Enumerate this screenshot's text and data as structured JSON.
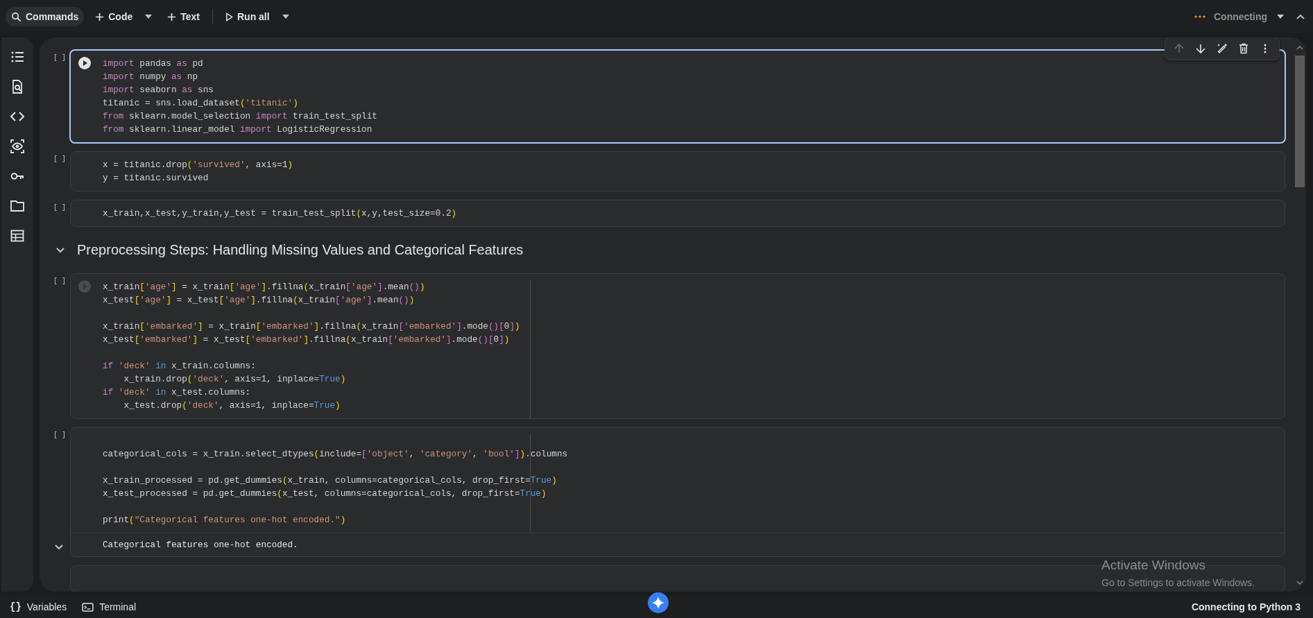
{
  "toolbar": {
    "commands": "Commands",
    "add_code": "Code",
    "add_text": "Text",
    "run_all": "Run all",
    "status": "Connecting"
  },
  "cell_toolbar": {
    "move_up_disabled": true
  },
  "cells": [
    {
      "kind": "code",
      "selected": true,
      "exec": "[ ]",
      "run_button": true,
      "run_button_dim": false,
      "ruler": false,
      "leading_blank": false,
      "blocks": [
        [
          [
            {
              "text": "import",
              "kind": "kw"
            },
            {
              "text": " pandas ",
              "kind": "p"
            },
            {
              "text": "as",
              "kind": "kw"
            },
            {
              "text": " pd",
              "kind": "p"
            }
          ],
          [
            {
              "text": "import",
              "kind": "kw"
            },
            {
              "text": " numpy ",
              "kind": "p"
            },
            {
              "text": "as",
              "kind": "kw"
            },
            {
              "text": " np",
              "kind": "p"
            }
          ],
          [
            {
              "text": "import",
              "kind": "kw"
            },
            {
              "text": " seaborn ",
              "kind": "p"
            },
            {
              "text": "as",
              "kind": "kw"
            },
            {
              "text": " sns",
              "kind": "p"
            }
          ],
          [
            {
              "text": "titanic = sns.load_dataset",
              "kind": "p"
            },
            {
              "text": "(",
              "kind": "b1"
            },
            {
              "text": "'titanic'",
              "kind": "s"
            },
            {
              "text": ")",
              "kind": "b1"
            }
          ],
          [
            {
              "text": "from",
              "kind": "kw"
            },
            {
              "text": " sklearn.model_selection ",
              "kind": "p"
            },
            {
              "text": "import",
              "kind": "kw"
            },
            {
              "text": " train_test_split",
              "kind": "p"
            }
          ],
          [
            {
              "text": "from",
              "kind": "kw"
            },
            {
              "text": " sklearn.linear_model ",
              "kind": "p"
            },
            {
              "text": "import",
              "kind": "kw"
            },
            {
              "text": " LogisticRegression",
              "kind": "p"
            }
          ]
        ]
      ]
    },
    {
      "kind": "code",
      "selected": false,
      "exec": "[ ]",
      "run_button": false,
      "ruler": false,
      "leading_blank": false,
      "blocks": [
        [
          [
            {
              "text": "x = titanic.drop",
              "kind": "p"
            },
            {
              "text": "(",
              "kind": "b1"
            },
            {
              "text": "'survived'",
              "kind": "s"
            },
            {
              "text": ", axis=1",
              "kind": "p"
            },
            {
              "text": ")",
              "kind": "b1"
            }
          ],
          [
            {
              "text": "y = titanic.survived",
              "kind": "p"
            }
          ]
        ]
      ]
    },
    {
      "kind": "code",
      "selected": false,
      "exec": "[ ]",
      "run_button": false,
      "ruler": false,
      "leading_blank": false,
      "blocks": [
        [
          [
            {
              "text": "x_train,x_test,y_train,y_test = train_test_split",
              "kind": "p"
            },
            {
              "text": "(",
              "kind": "b1"
            },
            {
              "text": "x,y,test_size=0.2",
              "kind": "p"
            },
            {
              "text": ")",
              "kind": "b1"
            }
          ]
        ]
      ]
    },
    {
      "kind": "heading",
      "text": "Preprocessing Steps: Handling Missing Values and Categorical Features",
      "expanded": true
    },
    {
      "kind": "code",
      "selected": false,
      "exec": "[ ]",
      "run_button": true,
      "run_button_dim": true,
      "ruler": true,
      "leading_blank": false,
      "blocks": [
        [
          [
            {
              "text": "x_train",
              "kind": "p"
            },
            {
              "text": "[",
              "kind": "b1"
            },
            {
              "text": "'age'",
              "kind": "s"
            },
            {
              "text": "]",
              "kind": "b1"
            },
            {
              "text": " = x_train",
              "kind": "p"
            },
            {
              "text": "[",
              "kind": "b1"
            },
            {
              "text": "'age'",
              "kind": "s"
            },
            {
              "text": "]",
              "kind": "b1"
            },
            {
              "text": ".fillna",
              "kind": "p"
            },
            {
              "text": "(",
              "kind": "b1"
            },
            {
              "text": "x_train",
              "kind": "p"
            },
            {
              "text": "[",
              "kind": "b2"
            },
            {
              "text": "'age'",
              "kind": "s"
            },
            {
              "text": "]",
              "kind": "b2"
            },
            {
              "text": ".mean",
              "kind": "p"
            },
            {
              "text": "()",
              "kind": "b2"
            },
            {
              "text": ")",
              "kind": "b1"
            }
          ],
          [
            {
              "text": "x_test",
              "kind": "p"
            },
            {
              "text": "[",
              "kind": "b1"
            },
            {
              "text": "'age'",
              "kind": "s"
            },
            {
              "text": "]",
              "kind": "b1"
            },
            {
              "text": " = x_test",
              "kind": "p"
            },
            {
              "text": "[",
              "kind": "b1"
            },
            {
              "text": "'age'",
              "kind": "s"
            },
            {
              "text": "]",
              "kind": "b1"
            },
            {
              "text": ".fillna",
              "kind": "p"
            },
            {
              "text": "(",
              "kind": "b1"
            },
            {
              "text": "x_train",
              "kind": "p"
            },
            {
              "text": "[",
              "kind": "b2"
            },
            {
              "text": "'age'",
              "kind": "s"
            },
            {
              "text": "]",
              "kind": "b2"
            },
            {
              "text": ".mean",
              "kind": "p"
            },
            {
              "text": "()",
              "kind": "b2"
            },
            {
              "text": ")",
              "kind": "b1"
            }
          ]
        ],
        [
          [
            {
              "text": "x_train",
              "kind": "p"
            },
            {
              "text": "[",
              "kind": "b1"
            },
            {
              "text": "'embarked'",
              "kind": "s"
            },
            {
              "text": "]",
              "kind": "b1"
            },
            {
              "text": " = x_train",
              "kind": "p"
            },
            {
              "text": "[",
              "kind": "b1"
            },
            {
              "text": "'embarked'",
              "kind": "s"
            },
            {
              "text": "]",
              "kind": "b1"
            },
            {
              "text": ".fillna",
              "kind": "p"
            },
            {
              "text": "(",
              "kind": "b1"
            },
            {
              "text": "x_train",
              "kind": "p"
            },
            {
              "text": "[",
              "kind": "b2"
            },
            {
              "text": "'embarked'",
              "kind": "s"
            },
            {
              "text": "]",
              "kind": "b2"
            },
            {
              "text": ".mode",
              "kind": "p"
            },
            {
              "text": "()",
              "kind": "b2"
            },
            {
              "text": "[",
              "kind": "b2"
            },
            {
              "text": "0",
              "kind": "p"
            },
            {
              "text": "]",
              "kind": "b2"
            },
            {
              "text": ")",
              "kind": "b1"
            }
          ],
          [
            {
              "text": "x_test",
              "kind": "p"
            },
            {
              "text": "[",
              "kind": "b1"
            },
            {
              "text": "'embarked'",
              "kind": "s"
            },
            {
              "text": "]",
              "kind": "b1"
            },
            {
              "text": " = x_test",
              "kind": "p"
            },
            {
              "text": "[",
              "kind": "b1"
            },
            {
              "text": "'embarked'",
              "kind": "s"
            },
            {
              "text": "]",
              "kind": "b1"
            },
            {
              "text": ".fillna",
              "kind": "p"
            },
            {
              "text": "(",
              "kind": "b1"
            },
            {
              "text": "x_train",
              "kind": "p"
            },
            {
              "text": "[",
              "kind": "b2"
            },
            {
              "text": "'embarked'",
              "kind": "s"
            },
            {
              "text": "]",
              "kind": "b2"
            },
            {
              "text": ".mode",
              "kind": "p"
            },
            {
              "text": "()",
              "kind": "b2"
            },
            {
              "text": "[",
              "kind": "b2"
            },
            {
              "text": "0",
              "kind": "p"
            },
            {
              "text": "]",
              "kind": "b2"
            },
            {
              "text": ")",
              "kind": "b1"
            }
          ]
        ],
        [
          [
            {
              "text": "if",
              "kind": "kw"
            },
            {
              "text": " 'deck'",
              "kind": "s"
            },
            {
              "text": " in",
              "kind": "c"
            },
            {
              "text": " x_train.columns:",
              "kind": "p"
            }
          ],
          [
            {
              "text": "    x_train.drop",
              "kind": "p"
            },
            {
              "text": "(",
              "kind": "b1"
            },
            {
              "text": "'deck'",
              "kind": "s"
            },
            {
              "text": ", axis=1, inplace=",
              "kind": "p"
            },
            {
              "text": "True",
              "kind": "c"
            },
            {
              "text": ")",
              "kind": "b1"
            }
          ],
          [
            {
              "text": "if",
              "kind": "kw"
            },
            {
              "text": " 'deck'",
              "kind": "s"
            },
            {
              "text": " in",
              "kind": "c"
            },
            {
              "text": " x_test.columns:",
              "kind": "p"
            }
          ],
          [
            {
              "text": "    x_test.drop",
              "kind": "p"
            },
            {
              "text": "(",
              "kind": "b1"
            },
            {
              "text": "'deck'",
              "kind": "s"
            },
            {
              "text": ", axis=1, inplace=",
              "kind": "p"
            },
            {
              "text": "True",
              "kind": "c"
            },
            {
              "text": ")",
              "kind": "b1"
            }
          ]
        ]
      ]
    },
    {
      "kind": "code",
      "selected": false,
      "exec": "[ ]",
      "run_button": false,
      "ruler": true,
      "leading_blank": true,
      "blocks": [
        [
          [
            {
              "text": "categorical_cols = x_train.select_dtypes",
              "kind": "p"
            },
            {
              "text": "(",
              "kind": "b1"
            },
            {
              "text": "include=",
              "kind": "p"
            },
            {
              "text": "[",
              "kind": "b2"
            },
            {
              "text": "'object'",
              "kind": "s"
            },
            {
              "text": ", ",
              "kind": "p"
            },
            {
              "text": "'category'",
              "kind": "s"
            },
            {
              "text": ", ",
              "kind": "p"
            },
            {
              "text": "'bool'",
              "kind": "s"
            },
            {
              "text": "]",
              "kind": "b2"
            },
            {
              "text": ")",
              "kind": "b1"
            },
            {
              "text": ".columns",
              "kind": "p"
            }
          ]
        ],
        [
          [
            {
              "text": "x_train_processed = pd.get_dummies",
              "kind": "p"
            },
            {
              "text": "(",
              "kind": "b1"
            },
            {
              "text": "x_train, columns=categorical_cols, drop_first=",
              "kind": "p"
            },
            {
              "text": "True",
              "kind": "c"
            },
            {
              "text": ")",
              "kind": "b1"
            }
          ],
          [
            {
              "text": "x_test_processed = pd.get_dummies",
              "kind": "p"
            },
            {
              "text": "(",
              "kind": "b1"
            },
            {
              "text": "x_test, columns=categorical_cols, drop_first=",
              "kind": "p"
            },
            {
              "text": "True",
              "kind": "c"
            },
            {
              "text": ")",
              "kind": "b1"
            }
          ]
        ],
        [
          [
            {
              "text": "print",
              "kind": "p"
            },
            {
              "text": "(",
              "kind": "b1"
            },
            {
              "text": "\"Categorical features one-hot encoded.\"",
              "kind": "s"
            },
            {
              "text": ")",
              "kind": "b1"
            }
          ]
        ]
      ],
      "output": {
        "text": "Categorical features one-hot encoded.",
        "expanded": true
      }
    },
    {
      "kind": "code",
      "selected": false,
      "run_button": false,
      "ruler": false,
      "leading_blank": false
    }
  ],
  "activation": {
    "title": "Activate Windows",
    "subtitle": "Go to Settings to activate Windows."
  },
  "bottom_bar": {
    "variables_icon": "{}",
    "variables": "Variables",
    "terminal": "Terminal",
    "status": "Connecting to Python 3"
  }
}
